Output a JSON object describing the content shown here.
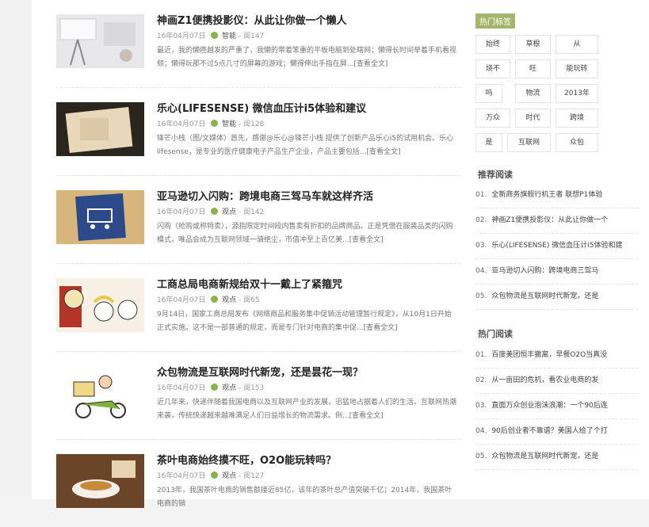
{
  "articles": [
    {
      "title": "神画Z1便携投影仪：从此让你做一个懒人",
      "date": "16年04月07日",
      "category": "智能",
      "views": "阅147",
      "excerpt": "最近，我的懒癌越发的严重了，我懒的带着笨重的平板电脑到处瞎网；懒得长时间举着手机看视频；懒得玩那不过5点几寸的屏幕的游戏；懒得伸出手指在屏...[查看全文]"
    },
    {
      "title": "乐心(LIFESENSE) 微信血压计i5体验和建议",
      "date": "16年04月07日",
      "category": "智能",
      "views": "阅128",
      "excerpt": "锋芒小栈（图/文媒体）首先，感谢@乐心@锋芒小栈 提供了创新产品乐心i5的试用机会。乐心lifesense，是专业的医疗健康电子产品生产企业，产品主要包括...[查看全文]"
    },
    {
      "title": "亚马逊切入闪购：跨境电商三驾马车就这样齐活",
      "date": "16年04月07日",
      "category": "观点",
      "views": "阅142",
      "excerpt": "闪购（抢购或称特卖），源指限定时间段内售卖有折扣的品牌商品。正是凭借在服装品类的闪购模式，唯品会成为互联网领域一骑绝尘，市值冲至上百亿美...[查看全文]"
    },
    {
      "title": "工商总局电商新规给双十一戴上了紧箍咒",
      "date": "16年04月07日",
      "category": "观点",
      "views": "阅65",
      "excerpt": "9月14日，国家工商总局发布《网络商品和服务集中促销活动管理暂行规定》，从10月1日开始正式实施。这不是一部普通的规定，而是专门针对电商的集中促...[查看全文]"
    },
    {
      "title": "众包物流是互联网时代新宠，还是昙花一现？",
      "date": "16年04月07日",
      "category": "观点",
      "views": "阅153",
      "excerpt": "近几年来，快递伴随着我国电商以及互联网产业的发展，迅猛地占据着人们的生活。互联网热潮来袭，传统快递越来越难满足人们日益增长的物流需求。例...[查看全文]"
    },
    {
      "title": "茶叶电商始终摸不旺，O2O能玩转吗？",
      "date": "16年04月07日",
      "category": "观点",
      "views": "阅127",
      "excerpt": "2013年，我国茶叶电商的销售额接近85亿，该年的茶叶总产值突破千亿；2014年，我国茶叶电商的销"
    }
  ],
  "sidebar": {
    "tags_title": "热门标签",
    "tags": [
      "始终",
      "草根",
      "从",
      "烧不",
      "旺",
      "能玩转",
      "吗",
      "物流",
      "2013年",
      "万众",
      "时代",
      "跨境",
      "是",
      "互联网",
      "众包"
    ],
    "recommended_title": "推荐阅读",
    "recommended": [
      {
        "num": "01.",
        "text": "全新商务旗舰行机王者 联想P1体验"
      },
      {
        "num": "02.",
        "text": "神画Z1便携投影仪：从此让你做一个"
      },
      {
        "num": "03.",
        "text": "乐心(LIFESENSE) 微信血压计i5体验和建"
      },
      {
        "num": "04.",
        "text": "亚马逊切入闪购：跨境电商三驾马"
      },
      {
        "num": "05.",
        "text": "众包物流是互联网时代新宠，还是"
      }
    ],
    "hot_title": "热门阅读",
    "hot": [
      {
        "num": "01.",
        "text": "百度美团恒丰撤离，早餐O2O当真没"
      },
      {
        "num": "02.",
        "text": "从一亩田的危机，看农业电商的发"
      },
      {
        "num": "03.",
        "text": "直面万众创业泡沫浪潮：一个90后连"
      },
      {
        "num": "04.",
        "text": "90后创业者不靠谱？美国人给了个打"
      },
      {
        "num": "05.",
        "text": "众包物流是互联网时代新宠，还是"
      }
    ]
  },
  "colors": {
    "tag_head_bg": "#a6b56e",
    "category_icon": "#8ab34a",
    "accent_red": "#d04a36"
  }
}
